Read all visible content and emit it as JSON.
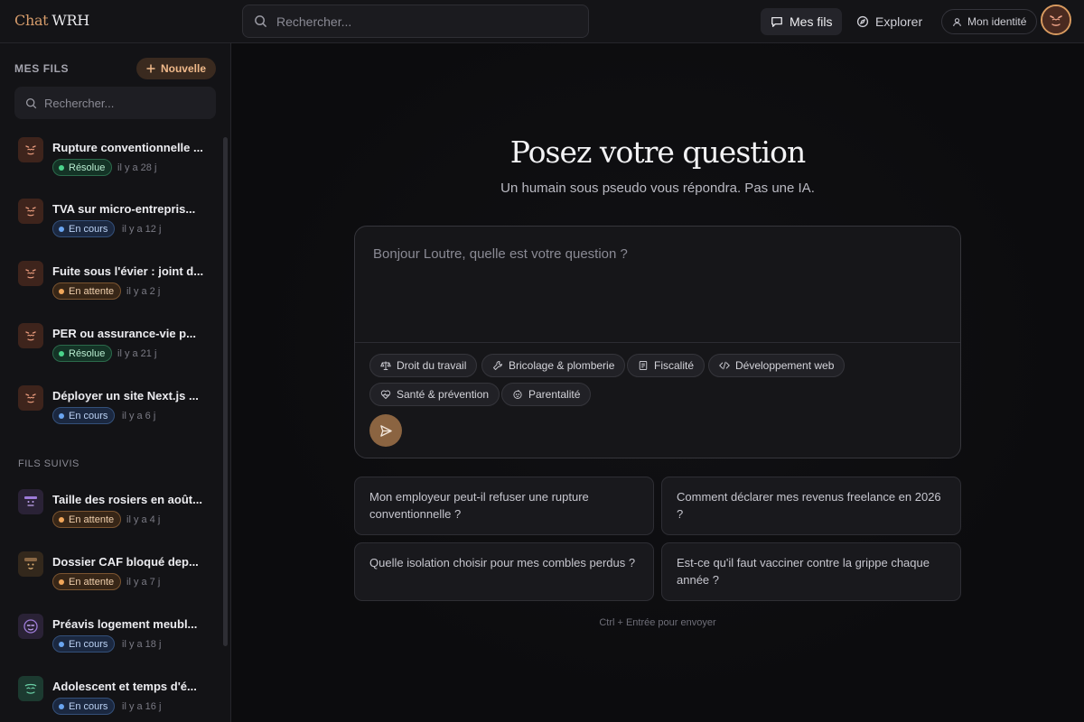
{
  "brand": {
    "part1": "Chat",
    "part2": "WRH"
  },
  "top_search": {
    "placeholder": "Rechercher..."
  },
  "nav": {
    "mes_fils": "Mes fils",
    "explorer": "Explorer",
    "identity": "Mon identité"
  },
  "sidebar": {
    "title": "MES FILS",
    "new_label": "Nouvelle",
    "search_placeholder": "Rechercher...",
    "section_followed": "FILS SUIVIS",
    "my_threads": [
      {
        "title": "Rupture conventionnelle ...",
        "status": "Résolue",
        "time": "il y a 28 j"
      },
      {
        "title": "TVA sur micro-entrepris...",
        "status": "En cours",
        "time": "il y a 12 j"
      },
      {
        "title": "Fuite sous l'évier : joint d...",
        "status": "En attente",
        "time": "il y a 2 j"
      },
      {
        "title": "PER ou assurance-vie p...",
        "status": "Résolue",
        "time": "il y a 21 j"
      },
      {
        "title": "Déployer un site Next.js ...",
        "status": "En cours",
        "time": "il y a 6 j"
      }
    ],
    "followed_threads": [
      {
        "title": "Taille des rosiers en août...",
        "status": "En attente",
        "time": "il y a 4 j"
      },
      {
        "title": "Dossier CAF bloqué dep...",
        "status": "En attente",
        "time": "il y a 7 j"
      },
      {
        "title": "Préavis logement meubl...",
        "status": "En cours",
        "time": "il y a 18 j"
      },
      {
        "title": "Adolescent et temps d'é...",
        "status": "En cours",
        "time": "il y a 16 j"
      }
    ]
  },
  "main": {
    "title": "Posez votre question",
    "subtitle": "Un humain sous pseudo vous répondra. Pas une IA.",
    "composer_placeholder": "Bonjour Loutre, quelle est votre question ?",
    "chips": [
      {
        "label": "Droit du travail",
        "icon": "scale-icon"
      },
      {
        "label": "Bricolage & plomberie",
        "icon": "wrench-icon"
      },
      {
        "label": "Fiscalité",
        "icon": "document-icon"
      },
      {
        "label": "Développement web",
        "icon": "code-icon"
      },
      {
        "label": "Santé & prévention",
        "icon": "heart-pulse-icon"
      },
      {
        "label": "Parentalité",
        "icon": "baby-icon"
      }
    ],
    "suggestions": [
      "Mon employeur peut-il refuser une rupture conventionnelle ?",
      "Comment déclarer mes revenus freelance en 2026 ?",
      "Quelle isolation choisir pour mes combles perdus ?",
      "Est-ce qu'il faut vacciner contre la grippe chaque année ?"
    ],
    "hint": "Ctrl + Entrée pour envoyer"
  },
  "colors": {
    "accent": "#d59b6a",
    "resolved": "#4ad48b",
    "in_progress": "#6aa5f0",
    "waiting": "#f0a65a"
  }
}
